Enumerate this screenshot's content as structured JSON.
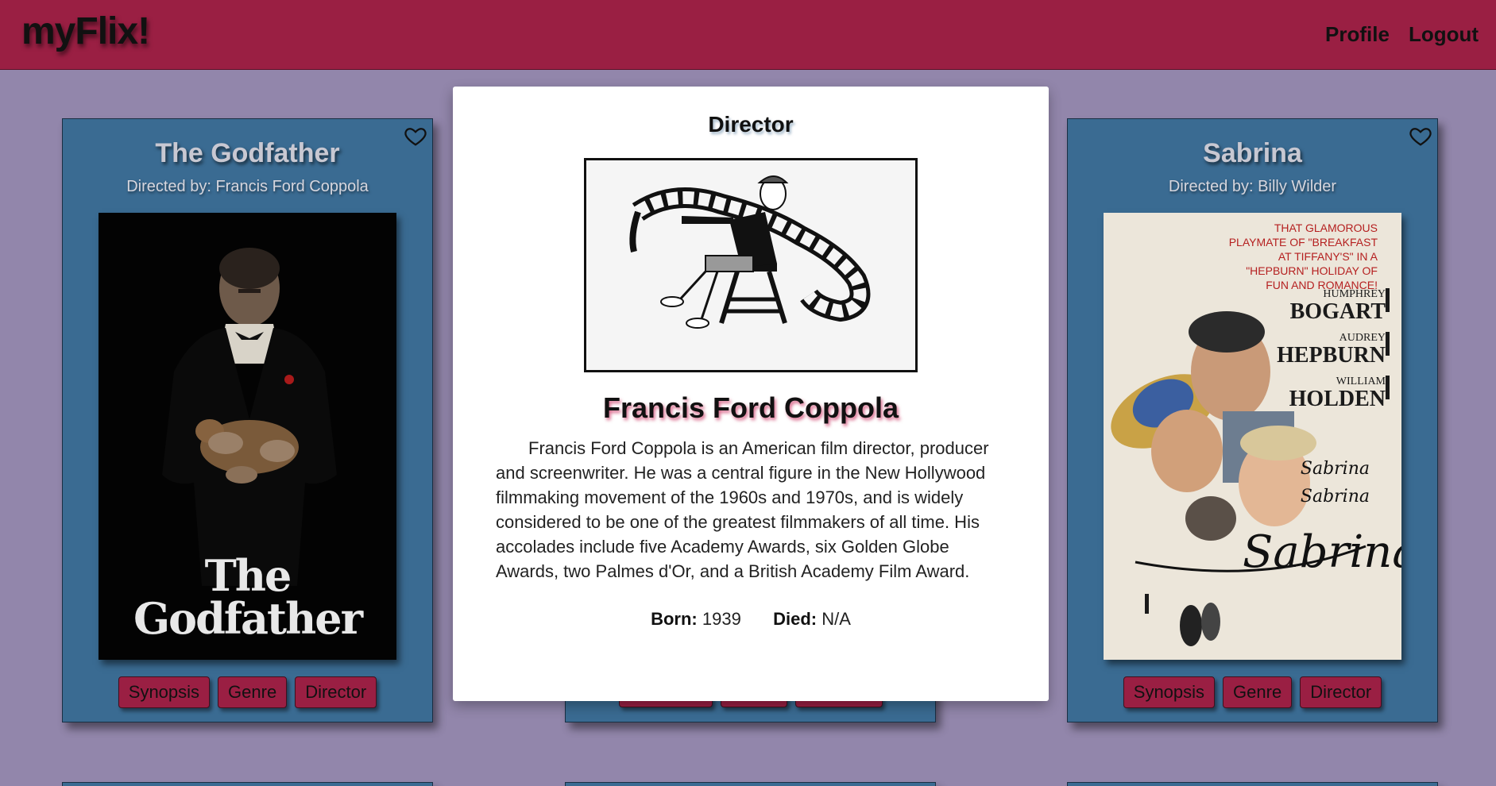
{
  "navbar": {
    "brand": "myFlix!",
    "links": {
      "profile": "Profile",
      "logout": "Logout"
    },
    "bg_color": "#9a1f43"
  },
  "page": {
    "bg_color": "#9286ab"
  },
  "cards": {
    "left": {
      "title": "The Godfather",
      "director_line": "Directed by: Francis Ford Coppola",
      "poster_text_line1": "The",
      "poster_text_line2": "Godfather",
      "buttons": {
        "synopsis": "Synopsis",
        "genre": "Genre",
        "director": "Director"
      },
      "favorite_icon": "heart-outline-icon"
    },
    "right": {
      "title": "Sabrina",
      "director_line": "Directed by: Billy Wilder",
      "poster": {
        "tagline": "THAT GLAMOROUS PLAYMATE OF \"BREAKFAST AT TIFFANY'S\" IN A \"HEPBURN\" HOLIDAY OF FUN AND ROMANCE!",
        "actors": [
          {
            "first": "HUMPHREY",
            "last": "BOGART"
          },
          {
            "first": "AUDREY",
            "last": "HEPBURN"
          },
          {
            "first": "WILLIAM",
            "last": "HOLDEN"
          }
        ],
        "script_title": "Sabrina",
        "small_script": "Sabrina"
      },
      "buttons": {
        "synopsis": "Synopsis",
        "genre": "Genre",
        "director": "Director"
      },
      "favorite_icon": "heart-outline-icon"
    }
  },
  "modal": {
    "heading": "Director",
    "name": "Francis Ford Coppola",
    "bio": "Francis Ford Coppola is an American film director, producer and screenwriter. He was a central figure in the New Hollywood filmmaking movement of the 1960s and 1970s, and is widely considered to be one of the greatest filmmakers of all time. His accolades include five Academy Awards, six Golden Globe Awards, two Palmes d'Or, and a British Academy Film Award.",
    "born_label": "Born:",
    "born_value": "1939",
    "died_label": "Died:",
    "died_value": "N/A",
    "image_icon": "director-chair-film-reel-illustration"
  },
  "colors": {
    "card_bg": "#3a6b92",
    "button_bg": "#9a1f43",
    "modal_bg": "#ffffff"
  }
}
